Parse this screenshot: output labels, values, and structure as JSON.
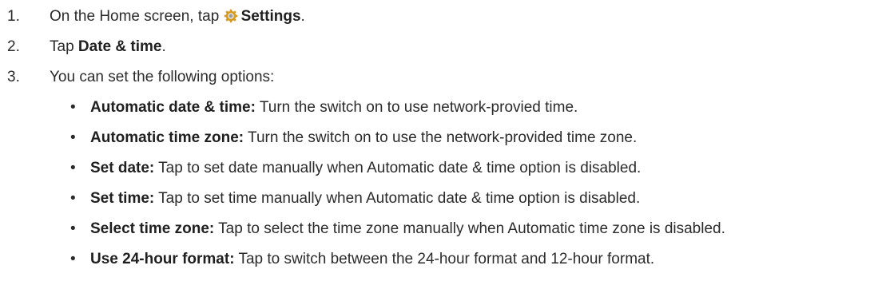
{
  "steps": [
    {
      "number": "1.",
      "prefix": "On the Home screen, tap ",
      "icon": "settings-gear-icon",
      "bold": "Settings",
      "suffix": "."
    },
    {
      "number": "2.",
      "prefix": "Tap ",
      "bold": "Date & time",
      "suffix": "."
    },
    {
      "number": "3.",
      "text": "You can set the following options:"
    }
  ],
  "options": [
    {
      "bullet": "•",
      "term": "Automatic date & time:",
      "description": " Turn the switch on to use network-provied time."
    },
    {
      "bullet": "•",
      "term": "Automatic time zone:",
      "description": " Turn the switch on to use the network-provided time zone."
    },
    {
      "bullet": "•",
      "term": "Set date:",
      "description": " Tap to set date manually when Automatic date & time option is disabled."
    },
    {
      "bullet": "•",
      "term": "Set time:",
      "description": " Tap to set time manually when Automatic date & time option is disabled."
    },
    {
      "bullet": "•",
      "term": "Select time zone:",
      "description": " Tap to select the time zone manually when Automatic time zone is disabled."
    },
    {
      "bullet": "•",
      "term": "Use 24-hour format:",
      "description": " Tap to switch between the 24-hour format and 12-hour format."
    }
  ],
  "colors": {
    "text": "#2b2b2b",
    "gear_outer": "#d79a1e",
    "gear_inner": "#9b9b9b"
  }
}
